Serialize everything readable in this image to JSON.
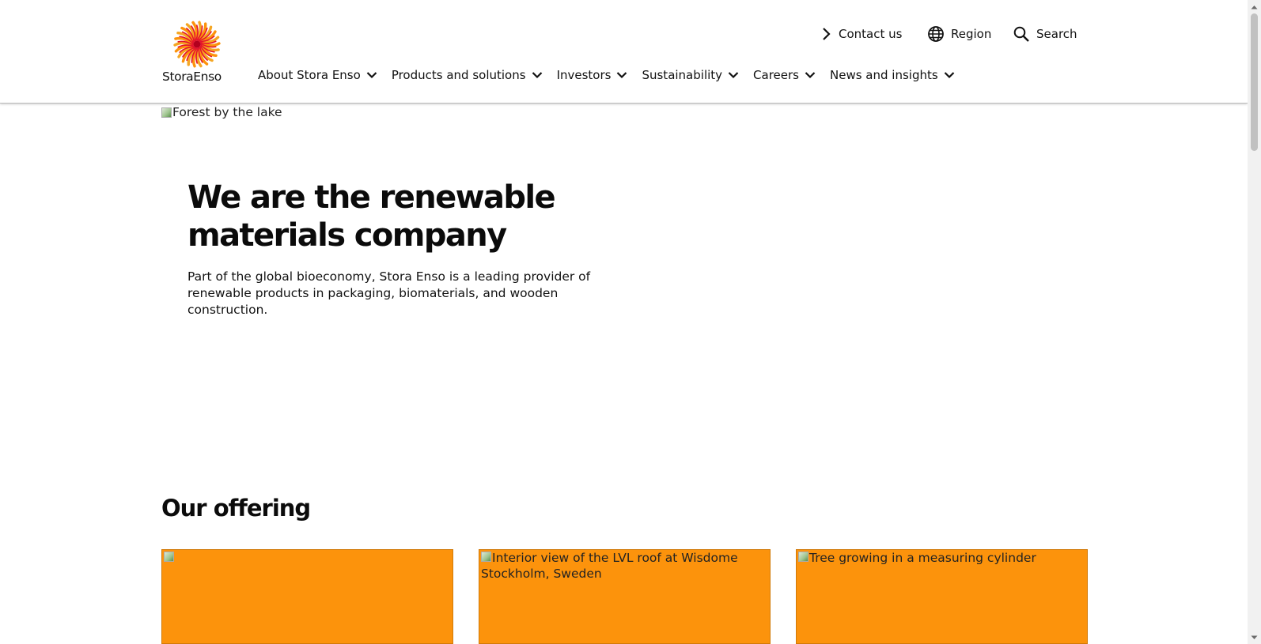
{
  "brand": {
    "name": "StoraEnso",
    "accent": "#fc930c",
    "logo_red": "#e4142d"
  },
  "utility_nav": {
    "contact": {
      "label": "Contact us",
      "icon": "chevron-right-icon"
    },
    "region": {
      "label": "Region",
      "icon": "globe-icon"
    },
    "search": {
      "label": "Search",
      "icon": "search-icon"
    }
  },
  "main_nav": {
    "items": [
      {
        "label": "About Stora Enso"
      },
      {
        "label": "Products and solutions"
      },
      {
        "label": "Investors"
      },
      {
        "label": "Sustainability"
      },
      {
        "label": "Careers"
      },
      {
        "label": "News and insights"
      }
    ]
  },
  "hero": {
    "image_alt": "Forest by the lake",
    "title": "We are the renewable materials company",
    "text": "Part of the global bioeconomy, Stora Enso is a leading provider of renewable products in packaging, biomaterials, and wooden construction."
  },
  "offering": {
    "title": "Our offering",
    "cards": [
      {
        "image_alt": ""
      },
      {
        "image_alt": "Interior view of the LVL roof at Wisdome Stockholm, Sweden"
      },
      {
        "image_alt": "Tree growing in a measuring cylinder"
      }
    ]
  }
}
